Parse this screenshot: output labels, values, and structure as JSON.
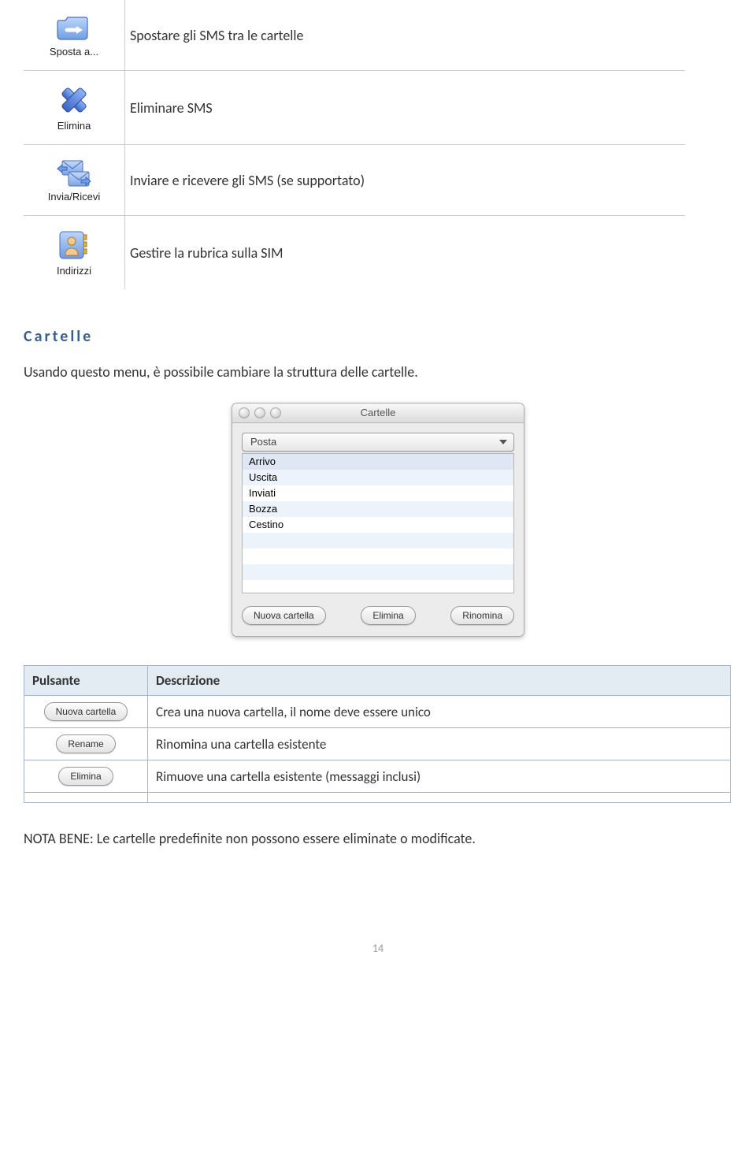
{
  "toolbar_items": [
    {
      "nameKey": "sposta",
      "label": "Sposta a...",
      "desc": "Spostare gli SMS tra le cartelle"
    },
    {
      "nameKey": "elimina",
      "label": "Elimina",
      "desc": "Eliminare SMS"
    },
    {
      "nameKey": "inviaric",
      "label": "Invia/Ricevi",
      "desc": "Inviare e ricevere gli SMS (se supportato)"
    },
    {
      "nameKey": "indirizzi",
      "label": "Indirizzi",
      "desc": "Gestire la rubrica sulla SIM"
    }
  ],
  "section_heading": "Cartelle",
  "section_text": "Usando questo menu, è possibile cambiare la struttura delle cartelle.",
  "cartelle_window": {
    "title": "Cartelle",
    "dropdown": "Posta",
    "items": [
      "Arrivo",
      "Uscita",
      "Inviati",
      "Bozza",
      "Cestino"
    ],
    "buttons": {
      "new": "Nuova cartella",
      "delete": "Elimina",
      "rename": "Rinomina"
    }
  },
  "desc_table": {
    "headers": {
      "col1": "Pulsante",
      "col2": "Descrizione"
    },
    "rows": [
      {
        "button": "Nuova cartella",
        "desc": "Crea una nuova cartella, il nome deve essere unico"
      },
      {
        "button": "Rename",
        "desc": "Rinomina una cartella esistente"
      },
      {
        "button": "Elimina",
        "desc": "Rimuove una cartella esistente (messaggi inclusi)"
      }
    ]
  },
  "note": "NOTA BENE: Le cartelle predefinite non possono essere eliminate o modificate.",
  "page_number": "14"
}
